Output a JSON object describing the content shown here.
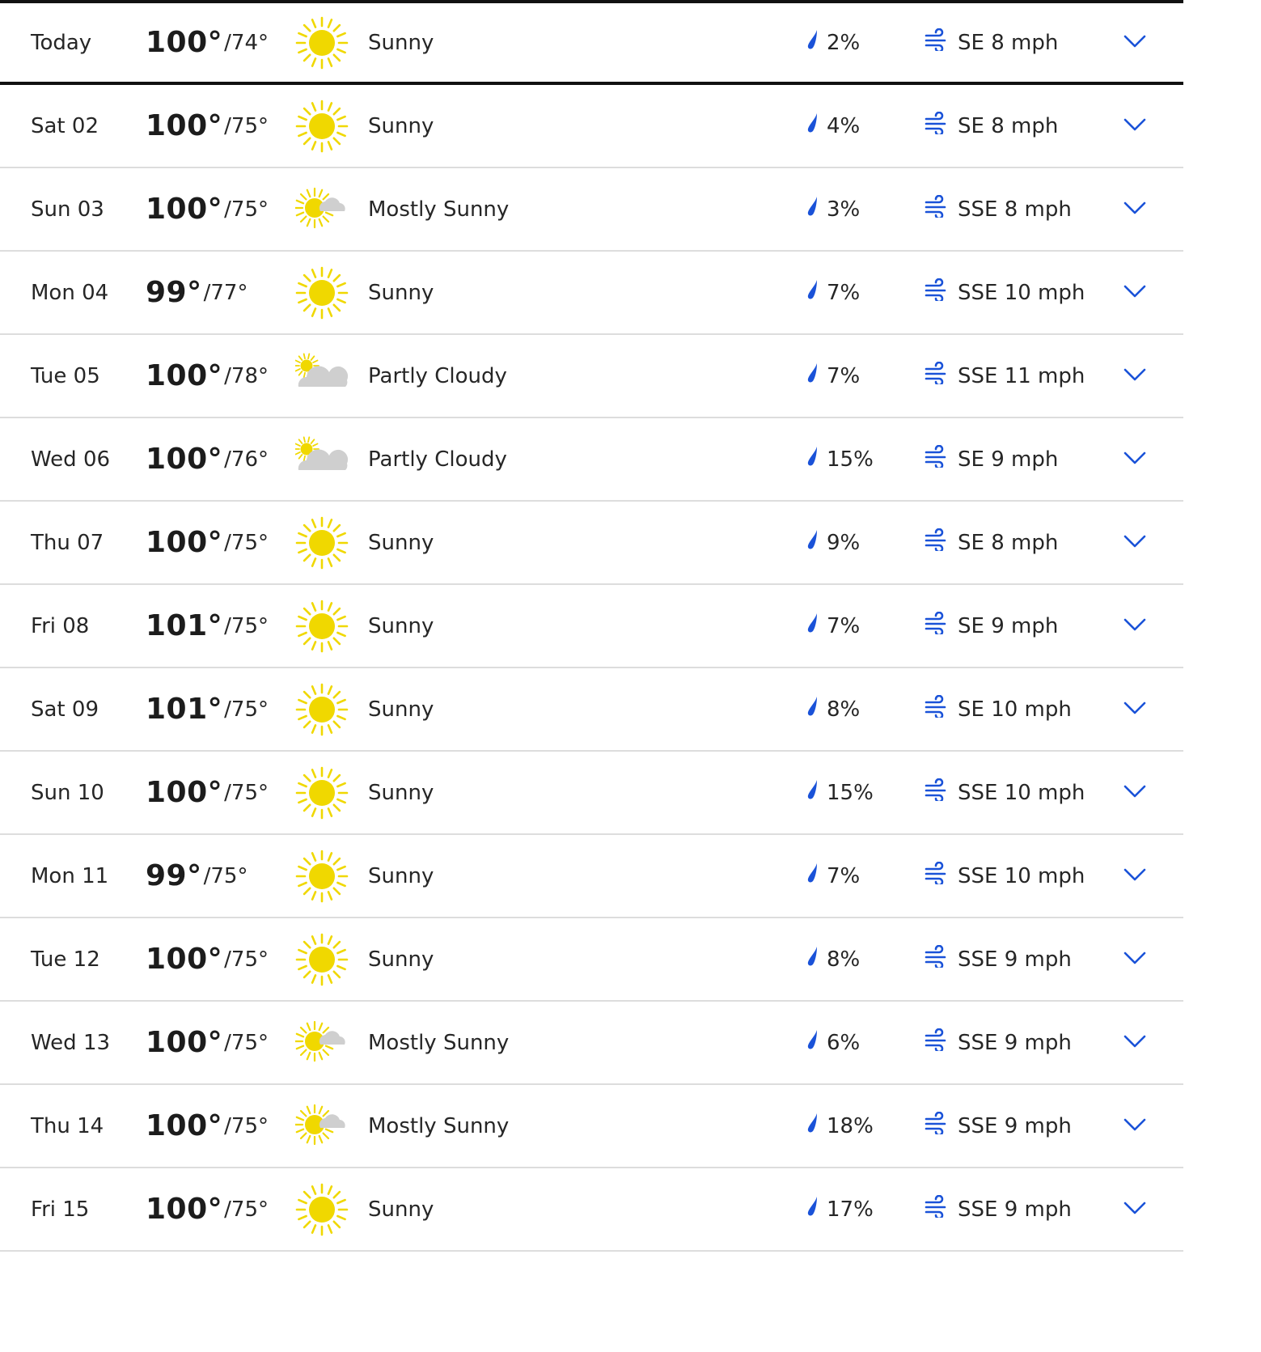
{
  "accent_color": "#1a52d8",
  "sun_color": "#f0d800",
  "cloud_color": "#cfcfcf",
  "icons": {
    "precip": "raindrop-icon",
    "wind": "wind-icon",
    "expand": "chevron-down-icon"
  },
  "days": [
    {
      "day": "Today",
      "hi": "100°",
      "lo": "/74°",
      "icon": "sunny",
      "condition": "Sunny",
      "precip": "2%",
      "wind": "SE 8 mph"
    },
    {
      "day": "Sat 02",
      "hi": "100°",
      "lo": "/75°",
      "icon": "sunny",
      "condition": "Sunny",
      "precip": "4%",
      "wind": "SE 8 mph"
    },
    {
      "day": "Sun 03",
      "hi": "100°",
      "lo": "/75°",
      "icon": "mostly-sunny",
      "condition": "Mostly Sunny",
      "precip": "3%",
      "wind": "SSE 8 mph"
    },
    {
      "day": "Mon 04",
      "hi": "99°",
      "lo": "/77°",
      "icon": "sunny",
      "condition": "Sunny",
      "precip": "7%",
      "wind": "SSE 10 mph"
    },
    {
      "day": "Tue 05",
      "hi": "100°",
      "lo": "/78°",
      "icon": "partly-cloudy",
      "condition": "Partly Cloudy",
      "precip": "7%",
      "wind": "SSE 11 mph"
    },
    {
      "day": "Wed 06",
      "hi": "100°",
      "lo": "/76°",
      "icon": "partly-cloudy",
      "condition": "Partly Cloudy",
      "precip": "15%",
      "wind": "SE 9 mph"
    },
    {
      "day": "Thu 07",
      "hi": "100°",
      "lo": "/75°",
      "icon": "sunny",
      "condition": "Sunny",
      "precip": "9%",
      "wind": "SE 8 mph"
    },
    {
      "day": "Fri 08",
      "hi": "101°",
      "lo": "/75°",
      "icon": "sunny",
      "condition": "Sunny",
      "precip": "7%",
      "wind": "SE 9 mph"
    },
    {
      "day": "Sat 09",
      "hi": "101°",
      "lo": "/75°",
      "icon": "sunny",
      "condition": "Sunny",
      "precip": "8%",
      "wind": "SE 10 mph"
    },
    {
      "day": "Sun 10",
      "hi": "100°",
      "lo": "/75°",
      "icon": "sunny",
      "condition": "Sunny",
      "precip": "15%",
      "wind": "SSE 10 mph"
    },
    {
      "day": "Mon 11",
      "hi": "99°",
      "lo": "/75°",
      "icon": "sunny",
      "condition": "Sunny",
      "precip": "7%",
      "wind": "SSE 10 mph"
    },
    {
      "day": "Tue 12",
      "hi": "100°",
      "lo": "/75°",
      "icon": "sunny",
      "condition": "Sunny",
      "precip": "8%",
      "wind": "SSE 9 mph"
    },
    {
      "day": "Wed 13",
      "hi": "100°",
      "lo": "/75°",
      "icon": "mostly-sunny",
      "condition": "Mostly Sunny",
      "precip": "6%",
      "wind": "SSE 9 mph"
    },
    {
      "day": "Thu 14",
      "hi": "100°",
      "lo": "/75°",
      "icon": "mostly-sunny",
      "condition": "Mostly Sunny",
      "precip": "18%",
      "wind": "SSE 9 mph"
    },
    {
      "day": "Fri 15",
      "hi": "100°",
      "lo": "/75°",
      "icon": "sunny",
      "condition": "Sunny",
      "precip": "17%",
      "wind": "SSE 9 mph"
    }
  ]
}
